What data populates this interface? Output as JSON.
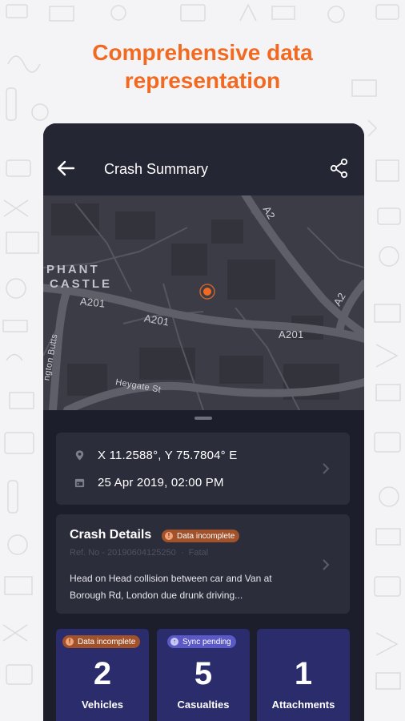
{
  "headline": {
    "line1": "Comprehensive data",
    "line2": "representation"
  },
  "appbar": {
    "title": "Crash Summary",
    "back_icon": "arrow-left-icon",
    "share_icon": "share-icon"
  },
  "map": {
    "place_line1": "PHANT",
    "place_line2": "CASTLE",
    "roads": {
      "a201_left": "A201",
      "a201_mid": "A201",
      "a201_right": "A201",
      "a2_top": "A2",
      "a2_right": "A2",
      "heygate": "Heygate St",
      "butts": "ngton Butts"
    },
    "marker_icon": "location-marker-icon",
    "colors": {
      "marker": "#f26a21"
    }
  },
  "location": {
    "coordinates": "X 11.2588°,  Y  75.7804° E",
    "datetime": "25 Apr 2019, 02:00 PM",
    "pin_icon": "pin-icon",
    "calendar_icon": "calendar-icon"
  },
  "crash": {
    "title": "Crash Details",
    "badge": "Data incomplete",
    "ref": "Ref. No - 20190604125250",
    "severity": "Fatal",
    "description": "Head on Head collision between car and Van at Borough Rd, London due drunk driving..."
  },
  "stats": [
    {
      "value": "2",
      "label": "Vehicles",
      "badge": "Data incomplete"
    },
    {
      "value": "5",
      "label": "Casualties",
      "badge": "Sync pending"
    },
    {
      "value": "1",
      "label": "Attachments"
    }
  ],
  "colors": {
    "accent": "#f26a21",
    "warn_badge": "#a1522a",
    "sync_badge": "#5a59c5",
    "stat_card": "#2b2c6b"
  }
}
